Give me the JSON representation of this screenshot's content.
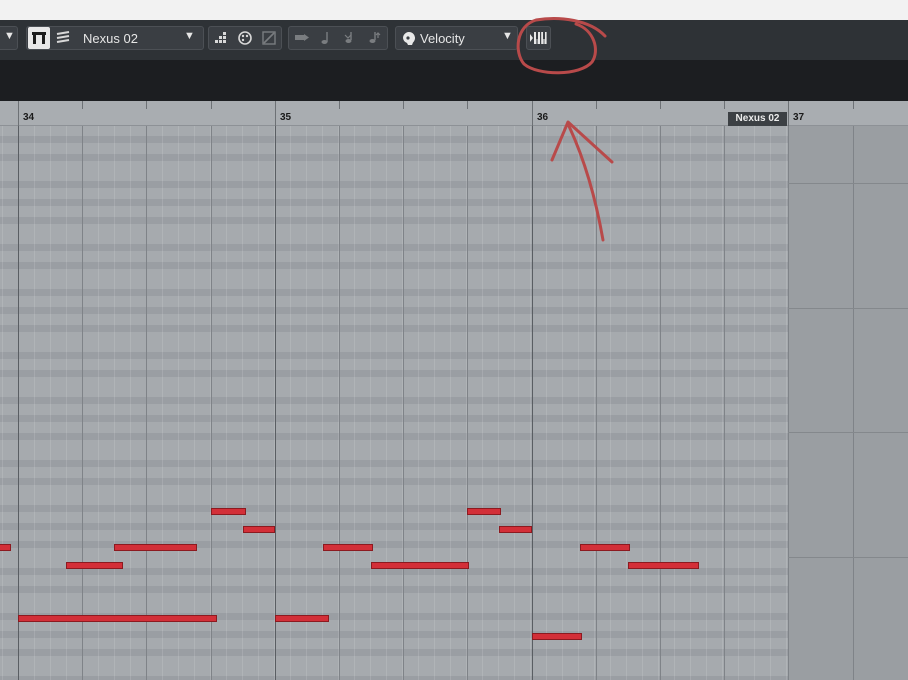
{
  "toolbar": {
    "track_selector": "Nexus 02",
    "controller_lane": "Velocity"
  },
  "ruler": {
    "bars": [
      "34",
      "35",
      "36",
      "37"
    ],
    "part_name": "Nexus 02"
  },
  "notes_color": "#d32f38",
  "annotation_color": "#b84a4a",
  "icons": [
    "dropdown-arrow",
    "object-selection-tool",
    "multi-lane-tool",
    "chord-tool",
    "color-palette",
    "mute-tool",
    "legato",
    "note-length",
    "quantize-down",
    "quantize-up",
    "velocity-head",
    "step-input-keyboard"
  ]
}
